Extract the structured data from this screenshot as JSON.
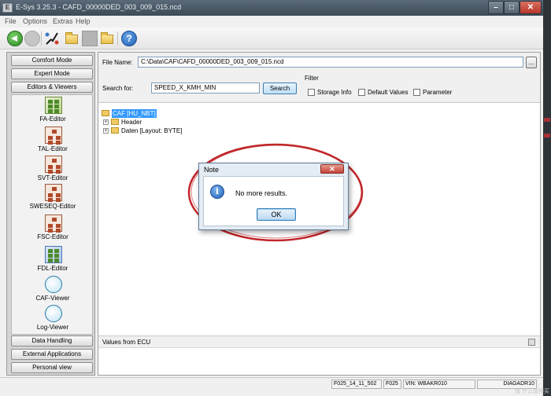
{
  "window": {
    "icon_text": "E",
    "title": "E-Sys 3.25.3 - CAFD_00000DED_003_009_015.ncd",
    "min_symbol": "–",
    "max_symbol": "□",
    "close_symbol": "✕"
  },
  "menu": [
    "File",
    "Options",
    "Extras",
    "Help"
  ],
  "toolbar": {
    "help_symbol": "?",
    "icons": [
      "back-icon",
      "forward-icon",
      "connect-icon",
      "open-icon",
      "save-icon",
      "save-as-icon",
      "help-icon"
    ]
  },
  "sidebar": {
    "top_buttons": [
      "Comfort Mode",
      "Expert Mode",
      "Editors & Viewers"
    ],
    "editors": [
      "FA-Editor",
      "TAL-Editor",
      "SVT-Editor",
      "SWESEQ-Editor",
      "FSC-Editor",
      "FDL-Editor",
      "CAF-Viewer",
      "Log-Viewer"
    ],
    "bottom_buttons": [
      "Data Handling",
      "External Applications",
      "Personal view"
    ]
  },
  "form": {
    "file_name_label": "File Name:",
    "file_name_value": "C:\\Data\\CAF\\CAFD_00000DED_003_009_015.ncd",
    "browse_label": "...",
    "search_label": "Search for:",
    "search_value": "SPEED_X_KMH_MIN",
    "search_button": "Search",
    "filter_label": "Filter",
    "filters": [
      {
        "label": "Storage Info",
        "checked": false
      },
      {
        "label": "Default Values",
        "checked": false
      },
      {
        "label": "Parameter",
        "checked": false
      }
    ]
  },
  "tree": {
    "root": "CAF [HU_NBT]",
    "children": [
      "Header",
      "Daten [Layout: BYTE]"
    ],
    "expander": "+"
  },
  "ecu_panel": {
    "label": "Values from ECU"
  },
  "status": [
    "F025_14_11_502",
    "F025",
    "VIN: WBAKR010",
    "DIAGADR10"
  ],
  "dialog": {
    "title": "Note",
    "close_symbol": "✕",
    "icon_symbol": "i",
    "message": "No more results.",
    "ok_label": "OK"
  },
  "watermark": "值 什么值得买",
  "colors": {
    "title_bar": "#3c4a57",
    "selection": "#3399ff",
    "annotation": "#c0262a"
  }
}
